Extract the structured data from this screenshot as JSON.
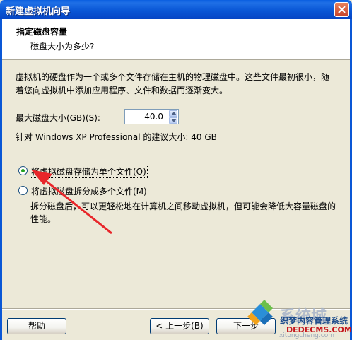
{
  "window": {
    "title": "新建虚拟机向导"
  },
  "header": {
    "title": "指定磁盘容量",
    "subtitle": "磁盘大小为多少?"
  },
  "description": "虚拟机的硬盘作为一个或多个文件存储在主机的物理磁盘中。这些文件最初很小，随着您向虚拟机中添加应用程序、文件和数据而逐渐变大。",
  "disk_size": {
    "label": "最大磁盘大小(GB)(S):",
    "value": "40.0"
  },
  "recommendation": "针对 Windows XP Professional 的建议大小: 40 GB",
  "options": [
    {
      "label": "将虚拟磁盘存储为单个文件(O)",
      "selected": true
    },
    {
      "label": "将虚拟磁盘拆分成多个文件(M)",
      "selected": false
    }
  ],
  "split_note": "拆分磁盘后，可以更轻松地在计算机之间移动虚拟机，但可能会降低大容量磁盘的性能。",
  "buttons": {
    "help": "帮助",
    "back": "< 上一步(B)",
    "next": "下一步"
  },
  "watermark": {
    "brand_top": "系统城",
    "brand_url": "xitongcheng.com",
    "site_cn": "织梦内容管理系统",
    "site_en": "DEDECMS.COM"
  },
  "colors": {
    "title_bar": "#0a57d6",
    "dialog_bg": "#ece9d8",
    "arrow": "#e8262a"
  }
}
